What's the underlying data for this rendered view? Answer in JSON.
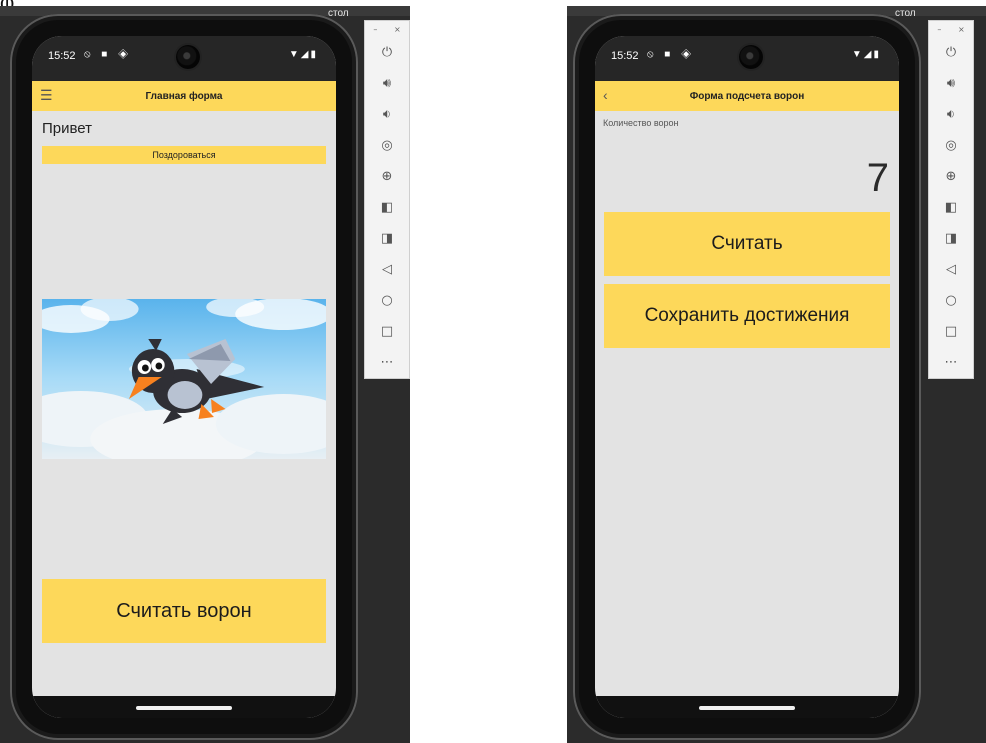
{
  "desktop": {
    "label_left": "стол",
    "label_right": "стол"
  },
  "left_phone": {
    "status": {
      "time": "15:52"
    },
    "appbar": {
      "title": "Главная форма",
      "menu_icon": "hamburger-menu-icon"
    },
    "greeting_label": "Привет",
    "greet_button": "Поздороваться",
    "image": {
      "subject": "cartoon crow flying in sky"
    },
    "count_button": "Считать ворон"
  },
  "right_phone": {
    "status": {
      "time": "15:52"
    },
    "appbar": {
      "title": "Форма подсчета ворон",
      "back_icon": "back-arrow-icon"
    },
    "count_label": "Количество ворон",
    "count_value": "7",
    "count_button": "Считать",
    "save_button": "Сохранить достижения"
  },
  "emulator_toolbar": {
    "buttons": [
      "power-icon",
      "volume-up-icon",
      "volume-down-icon",
      "screenshot-icon",
      "zoom-icon",
      "rotate-left-icon",
      "rotate-right-icon",
      "back-icon",
      "home-icon",
      "overview-icon",
      "more-icon"
    ],
    "window_controls": [
      "minimize-icon",
      "close-icon"
    ]
  },
  "colors": {
    "accent_yellow": "#fdd85a",
    "screen_bg": "#e3e3e3",
    "desktop_bg": "#2b2b2b"
  }
}
